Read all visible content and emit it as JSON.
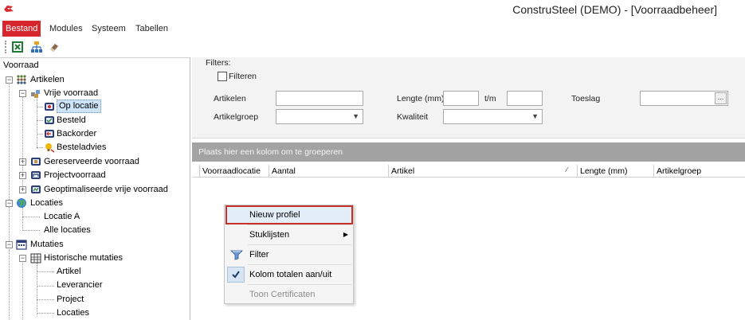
{
  "window": {
    "title": "ConstruSteel (DEMO) - [Voorraadbeheer]"
  },
  "menu": {
    "items": [
      "Bestand",
      "Modules",
      "Systeem",
      "Tabellen"
    ]
  },
  "toolbar": {
    "icons": [
      "excel-icon",
      "org-chart-icon",
      "eraser-icon"
    ]
  },
  "tree": {
    "title": "Voorraad",
    "nodes": {
      "artikelen": "Artikelen",
      "vrije_voorraad": "Vrije voorraad",
      "op_locatie": "Op locatie",
      "besteld": "Besteld",
      "backorder": "Backorder",
      "besteladvies": "Besteladvies",
      "gereserveerde": "Gereserveerde voorraad",
      "projectvoorraad": "Projectvoorraad",
      "geoptimaliseerde": "Geoptimaliseerde vrije voorraad",
      "locaties": "Locaties",
      "locatie_a": "Locatie A",
      "alle_locaties": "Alle locaties",
      "mutaties": "Mutaties",
      "historische": "Historische mutaties",
      "artikel": "Artikel",
      "leverancier": "Leverancier",
      "project": "Project",
      "locaties_sub": "Locaties"
    }
  },
  "filters": {
    "title": "Filters:",
    "filteren_label": "Filteren",
    "artikelen_label": "Artikelen",
    "artikelgroep_label": "Artikelgroep",
    "lengte_label": "Lengte (mm)",
    "tm_label": "t/m",
    "kwaliteit_label": "Kwaliteit",
    "toeslag_label": "Toeslag",
    "ellipsis": "..."
  },
  "grid": {
    "group_hint": "Plaats hier een kolom om te groeperen",
    "columns": [
      "Voorraadlocatie",
      "Aantal",
      "Artikel",
      "Lengte (mm)",
      "Artikelgroep"
    ]
  },
  "context_menu": {
    "items": {
      "nieuw_profiel": "Nieuw profiel",
      "stuklijsten": "Stuklijsten",
      "filter": "Filter",
      "kolom_totalen": "Kolom totalen aan/uit",
      "toon_certificaten": "Toon Certificaten"
    }
  },
  "colors": {
    "accent_red": "#d8262d",
    "selection": "#cde4f7",
    "group_panel": "#a3a3a3",
    "highlight_border": "#c9302c"
  }
}
